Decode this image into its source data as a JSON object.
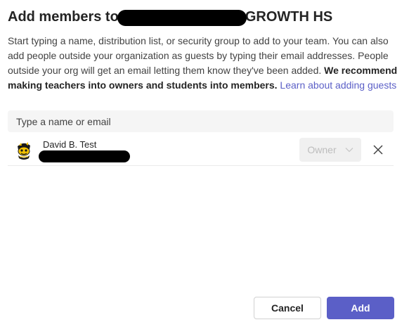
{
  "dialog": {
    "title_prefix": "Add members to",
    "title_suffix": "GROWTH HS",
    "description_text": "Start typing a name, distribution list, or security group to add to your team. You can also add people outside your organization as guests by typing their email addresses. People outside your org will get an email letting them know they've been added. ",
    "description_bold": "We recommend making teachers into owners and students into members.",
    "learn_more_link": "Learn about adding guests"
  },
  "search": {
    "placeholder": "Type a name or email",
    "value": ""
  },
  "members": [
    {
      "name": "David B. Test",
      "role": "Owner",
      "avatar_icon": "mascot-avatar-icon"
    }
  ],
  "footer": {
    "cancel_label": "Cancel",
    "add_label": "Add"
  },
  "colors": {
    "accent": "#5b5fc7",
    "text": "#242424",
    "input_bg": "#f5f5f5",
    "disabled_text": "#bdbdbd"
  }
}
